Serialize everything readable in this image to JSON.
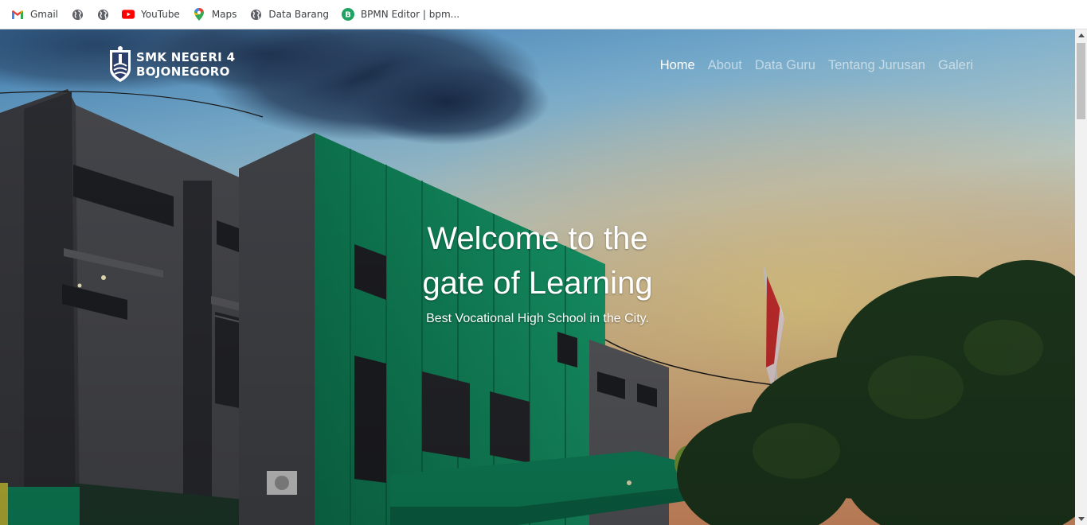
{
  "bookmarks": [
    {
      "label": "Gmail",
      "icon": "gmail-icon"
    },
    {
      "label": "",
      "icon": "globe-icon"
    },
    {
      "label": "",
      "icon": "globe-icon"
    },
    {
      "label": "YouTube",
      "icon": "youtube-icon"
    },
    {
      "label": "Maps",
      "icon": "maps-icon"
    },
    {
      "label": "Data Barang",
      "icon": "globe-icon"
    },
    {
      "label": "BPMN Editor | bpm...",
      "icon": "bpmn-icon"
    }
  ],
  "site": {
    "logo_line1": "SMK NEGERI 4",
    "logo_line2": "BOJONEGORO",
    "menu": [
      {
        "label": "Home",
        "active": true
      },
      {
        "label": "About",
        "active": false
      },
      {
        "label": "Data Guru",
        "active": false
      },
      {
        "label": "Tentang Jurusan",
        "active": false
      },
      {
        "label": "Galeri",
        "active": false
      }
    ]
  },
  "hero": {
    "title_line1": "Welcome to the",
    "title_line2": "gate of Learning",
    "subtitle": "Best Vocational High School in the City."
  },
  "colors": {
    "school_green": "#0f8a5f",
    "building_gray": "#4a4b50"
  }
}
